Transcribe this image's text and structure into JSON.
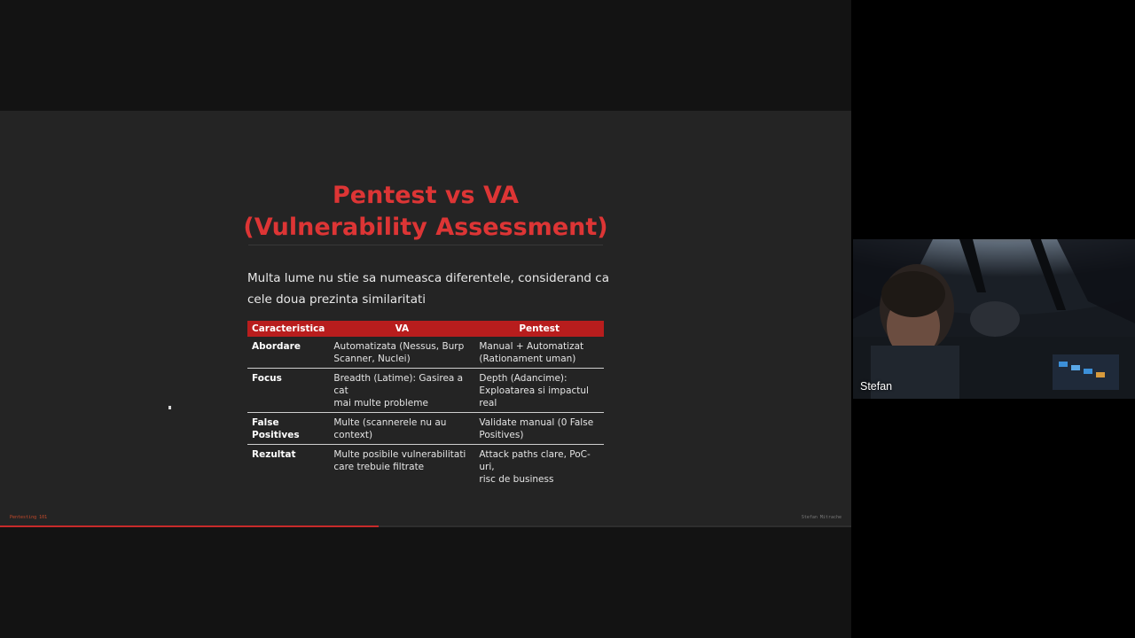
{
  "slide": {
    "title_line1": "Pentest vs VA",
    "title_line2": "(Vulnerability Assessment)",
    "intro_line1": "Multa lume nu stie sa numeasca diferentele, considerand ca",
    "intro_line2": "cele doua prezinta similaritati",
    "table": {
      "headers": [
        "Caracteristica",
        "VA",
        "Pentest"
      ],
      "rows": [
        {
          "label": "Abordare",
          "va_1": "Automatizata (Nessus, Burp",
          "va_2": "Scanner, Nuclei)",
          "pt_1": "Manual + Automatizat",
          "pt_2": "(Rationament uman)"
        },
        {
          "label": "Focus",
          "va_1": "Breadth (Latime): Gasirea a cat",
          "va_2": "mai multe probleme",
          "pt_1": "Depth (Adancime):",
          "pt_2": "Exploatarea si impactul real"
        },
        {
          "label_1": "False",
          "label_2": "Positives",
          "va_1": "Multe (scannerele nu au",
          "va_2": "context)",
          "pt_1": "Validate manual (0 False",
          "pt_2": "Positives)"
        },
        {
          "label": "Rezultat",
          "va_1": "Multe posibile vulnerabilitati",
          "va_2": "care trebuie filtrate",
          "pt_1": "Attack paths clare, PoC-uri,",
          "pt_2": "risc de business"
        }
      ]
    },
    "footer_left": "Pentesting 101",
    "footer_right": "Stefan Mitrache",
    "progress": 0.445,
    "colors": {
      "title": "#dd3535",
      "header_bg": "#b81d1d",
      "progress": "#c72a2a"
    }
  },
  "participants": [
    {
      "name": "Stefan"
    }
  ]
}
